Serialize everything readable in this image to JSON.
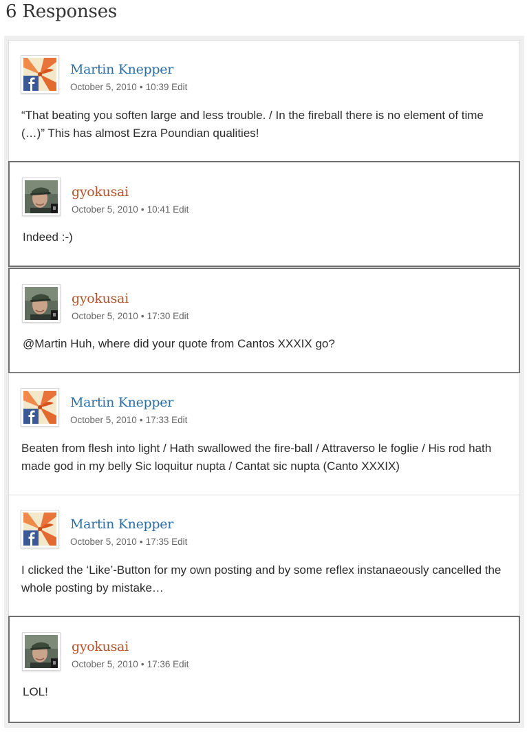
{
  "heading": "6 Responses",
  "comments": [
    {
      "name": "Martin Knepper",
      "date": "October 5, 2010",
      "time": "10:39",
      "edit": "Edit",
      "text": "“That beating you soften large and less trouble. / In the fireball there is no element of time (…)” This has almost Ezra Poundian qualities!"
    },
    {
      "name": "gyokusai",
      "date": "October 5, 2010",
      "time": "10:41",
      "edit": "Edit",
      "text": "Indeed :-)"
    },
    {
      "name": "gyokusai",
      "date": "October 5, 2010",
      "time": "17:30",
      "edit": "Edit",
      "text": "@Martin Huh, where did your quote from Cantos XXXIX go?"
    },
    {
      "name": "Martin Knepper",
      "date": "October 5, 2010",
      "time": "17:33",
      "edit": "Edit",
      "text": "Beaten from flesh into light / Hath swallowed the fire-ball / Attraverso le foglie / His rod hath made god in my belly Sic loquitur nupta / Cantat sic nupta (Canto XXXIX)"
    },
    {
      "name": "Martin Knepper",
      "date": "October 5, 2010",
      "time": "17:35",
      "edit": "Edit",
      "text": "I clicked the ‘Like’-Button for my own posting and by some reflex instanaeously cancelled the whole posting by mistake…"
    },
    {
      "name": "gyokusai",
      "date": "October 5, 2010",
      "time": "17:36",
      "edit": "Edit",
      "text": "LOL!"
    }
  ],
  "meta_separator": "•",
  "colors": {
    "visitor_name": "#2a6fa8",
    "author_name": "#b0542e",
    "author_border": "#707070"
  },
  "icons": {
    "martin_avatar": "facebook-badge-avatar",
    "gyokusai_avatar": "photo-avatar"
  }
}
